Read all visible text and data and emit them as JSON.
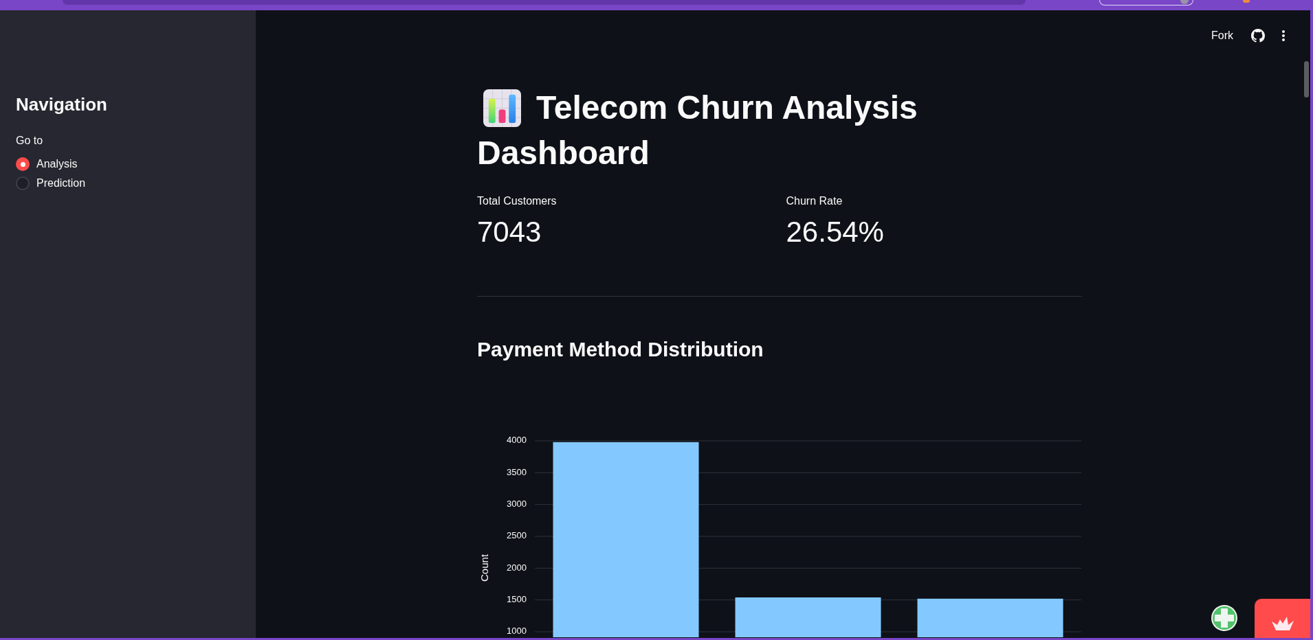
{
  "header": {
    "fork_label": "Fork"
  },
  "sidebar": {
    "title": "Navigation",
    "radio": {
      "label": "Go to",
      "options": [
        {
          "label": "Analysis",
          "selected": true
        },
        {
          "label": "Prediction",
          "selected": false
        }
      ]
    }
  },
  "main": {
    "title": [
      "Telecom Churn Analysis",
      "Dashboard"
    ],
    "metrics": [
      {
        "label": "Total Customers",
        "value": "7043"
      },
      {
        "label": "Churn Rate",
        "value": "26.54%"
      }
    ],
    "section_title": "Payment Method Distribution",
    "chart_data": {
      "type": "bar",
      "ylabel": "Count",
      "ylim": [
        914,
        4000
      ],
      "yticks": [
        1000,
        1500,
        2000,
        2500,
        3000,
        3500,
        4000
      ],
      "grid": true,
      "series": [
        {
          "color": "#83c9ff",
          "values": [
            3980,
            1540,
            1520
          ]
        }
      ]
    }
  }
}
